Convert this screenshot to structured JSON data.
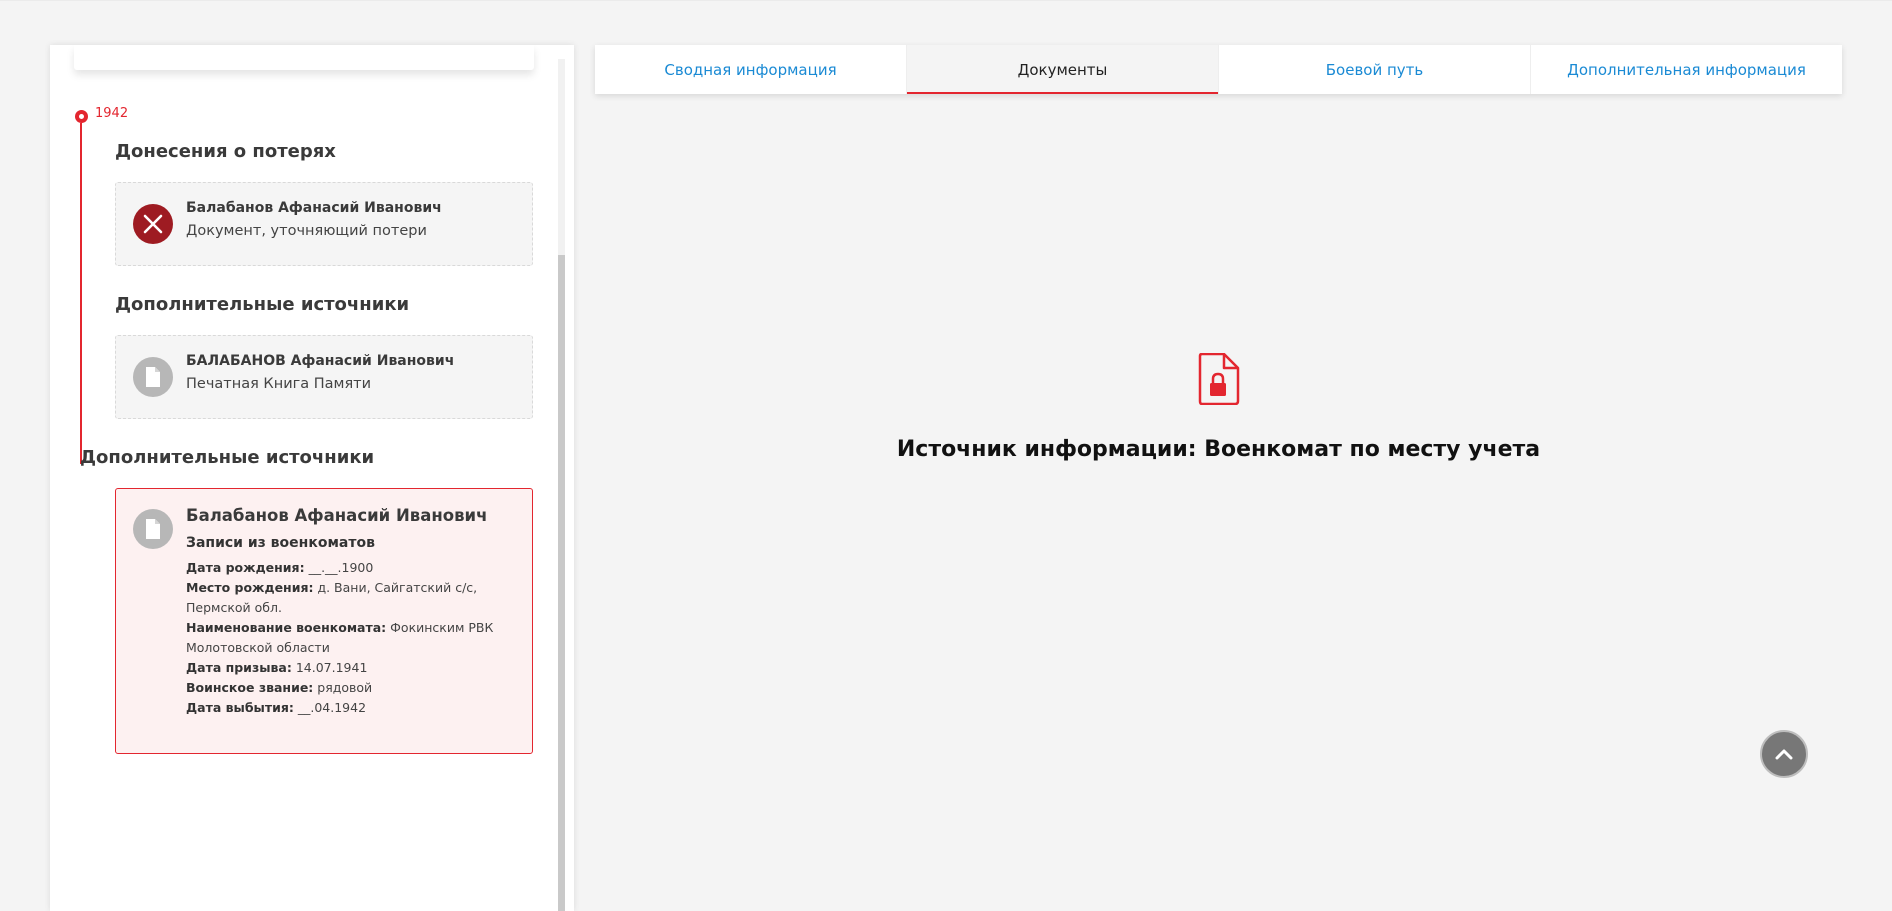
{
  "timeline": {
    "year": "1942"
  },
  "sections": {
    "losses": {
      "title": "Донесения о потерях",
      "card": {
        "name": "Балабанов Афанасий Иванович",
        "subtitle": "Документ, уточняющий потери",
        "icon": "close-icon"
      }
    },
    "additional_inner": {
      "title": "Дополнительные источники",
      "card": {
        "name": "БАЛАБАНОВ Афанасий Иванович",
        "subtitle": "Печатная Книга Памяти",
        "icon": "document-icon"
      }
    },
    "additional_outer": {
      "title": "Дополнительные источники",
      "card": {
        "name": "Балабанов Афанасий Иванович",
        "type": "Записи из военкоматов",
        "icon": "document-icon",
        "fields": [
          {
            "label": "Дата рождения:",
            "value": "__.__.1900"
          },
          {
            "label": "Место рождения:",
            "value": "д. Вани, Сайгатский с/с, Пермской обл."
          },
          {
            "label": "Наименование военкомата:",
            "value": "Фокинским РВК Молотовской области"
          },
          {
            "label": "Дата призыва:",
            "value": "14.07.1941"
          },
          {
            "label": "Воинское звание:",
            "value": "рядовой"
          },
          {
            "label": "Дата выбытия:",
            "value": "__.04.1942"
          }
        ]
      }
    }
  },
  "tabs": [
    {
      "label": "Сводная информация",
      "active": false
    },
    {
      "label": "Документы",
      "active": true
    },
    {
      "label": "Боевой путь",
      "active": false
    },
    {
      "label": "Дополнительная информация",
      "active": false
    }
  ],
  "main": {
    "icon": "locked-document-icon",
    "source_text": "Источник информации: Военкомат по месту учета"
  },
  "scroll_top": {
    "icon": "chevron-up-icon"
  },
  "colors": {
    "accent": "#e3262f",
    "link": "#1a8ad4",
    "loss_icon": "#9e1b22"
  }
}
